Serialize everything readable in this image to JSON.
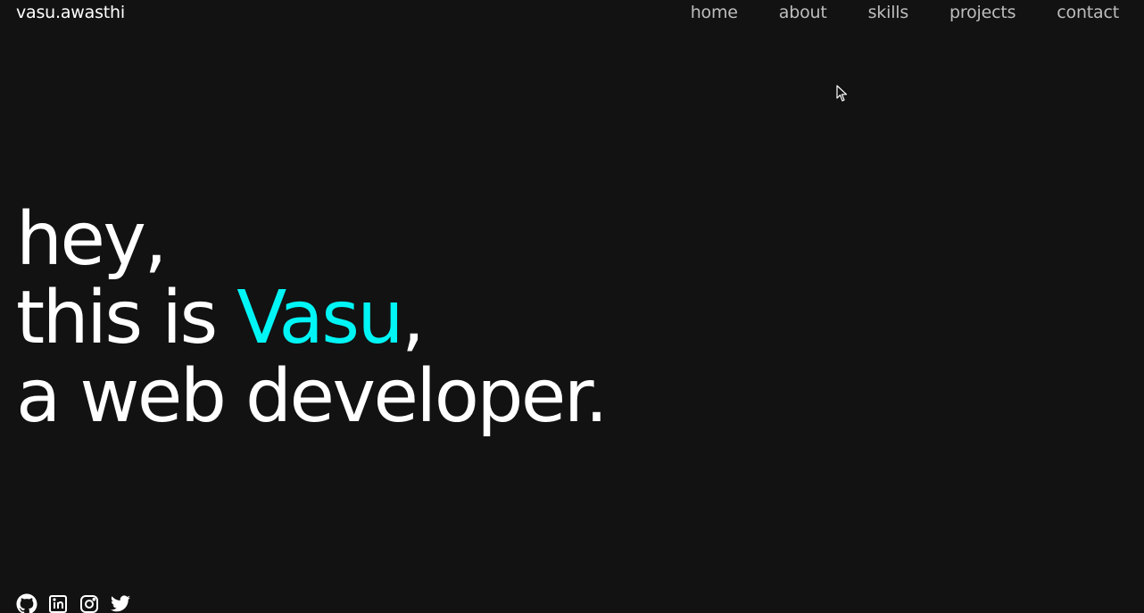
{
  "header": {
    "brand": "vasu.awasthi",
    "nav": [
      {
        "label": "home"
      },
      {
        "label": "about"
      },
      {
        "label": "skills"
      },
      {
        "label": "projects"
      },
      {
        "label": "contact"
      }
    ]
  },
  "hero": {
    "line1": "hey,",
    "line2_prefix": "this is ",
    "line2_name": "Vasu",
    "line2_suffix": ",",
    "line3": "a web developer."
  },
  "socials": [
    {
      "icon": "github-icon"
    },
    {
      "icon": "linkedin-icon"
    },
    {
      "icon": "instagram-icon"
    },
    {
      "icon": "twitter-icon"
    }
  ],
  "colors": {
    "background": "#121212",
    "text": "#ffffff",
    "nav_text": "#bdbdbd",
    "accent": "#00f5f5"
  }
}
